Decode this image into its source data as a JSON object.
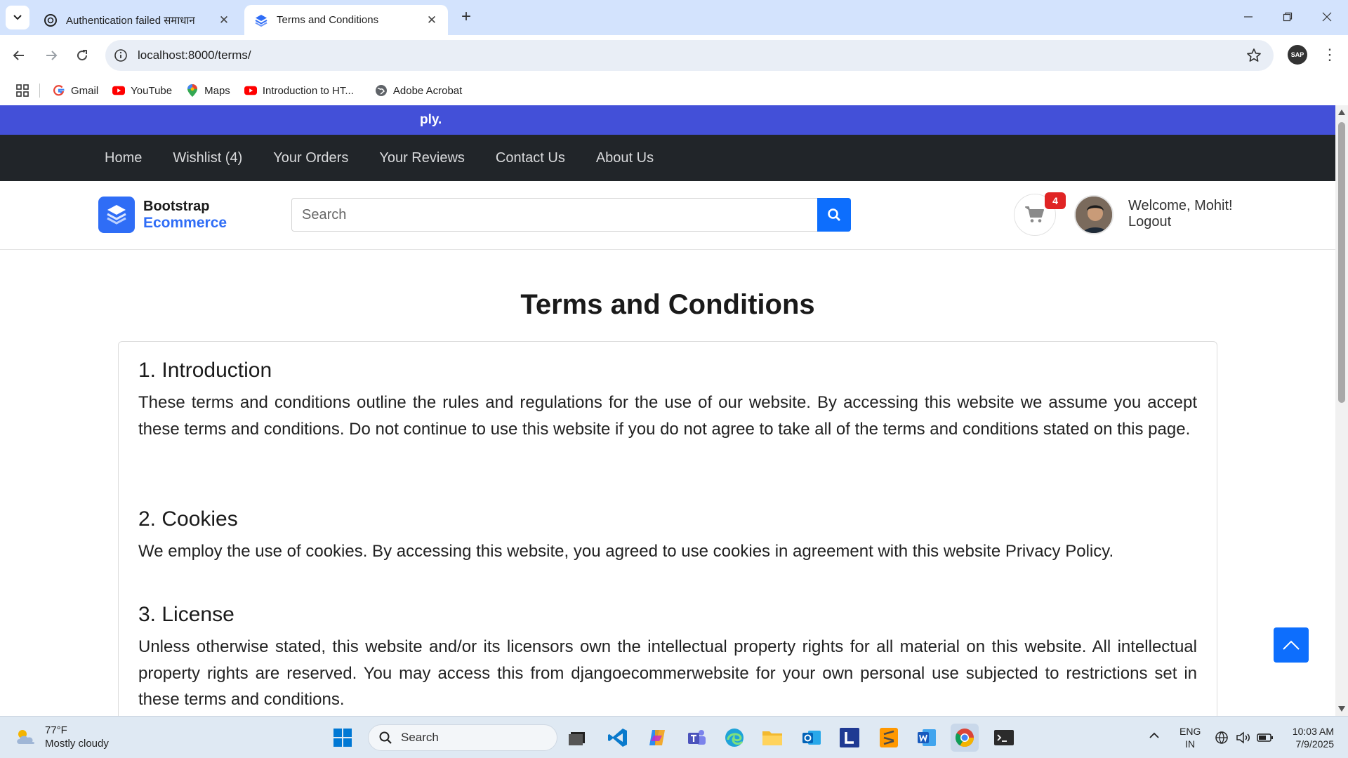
{
  "browser": {
    "tabs": [
      {
        "title": "Authentication failed समाधान",
        "active": false,
        "icon": "openai-icon"
      },
      {
        "title": "Terms and Conditions",
        "active": true,
        "icon": "layers-icon"
      }
    ],
    "url": "localhost:8000/terms/",
    "bookmarks": [
      {
        "label": "Gmail",
        "icon": "google-icon"
      },
      {
        "label": "YouTube",
        "icon": "youtube-icon"
      },
      {
        "label": "Maps",
        "icon": "maps-icon"
      },
      {
        "label": "Introduction to HT...",
        "icon": "youtube-icon"
      },
      {
        "label": "Adobe Acrobat",
        "icon": "globe-icon"
      }
    ],
    "profile_text": "SAP"
  },
  "site": {
    "topbar_text": "ply.",
    "nav": [
      "Home",
      "Wishlist (4)",
      "Your Orders",
      "Your Reviews",
      "Contact Us",
      "About Us"
    ],
    "brand": {
      "line1": "Bootstrap",
      "line2": "Ecommerce"
    },
    "search_placeholder": "Search",
    "cart_count": "4",
    "welcome": "Welcome, Mohit!",
    "logout": "Logout",
    "colors": {
      "topbar": "#4350d8",
      "navbar": "#212529",
      "primary": "#0d6efd",
      "badge": "#e02424"
    }
  },
  "content": {
    "title": "Terms and Conditions",
    "sections": [
      {
        "heading": "1. Introduction",
        "body": "These terms and conditions outline the rules and regulations for the use of our website. By accessing this website we assume you accept these terms and conditions. Do not continue to use this website if you do not agree to take all of the terms and conditions stated on this page."
      },
      {
        "heading": "2. Cookies",
        "body": "We employ the use of cookies. By accessing this website, you agreed to use cookies in agreement with this website Privacy Policy."
      },
      {
        "heading": "3. License",
        "body": "Unless otherwise stated, this website and/or its licensors own the intellectual property rights for all material on this website. All intellectual property rights are reserved. You may access this from djangoecommerwebsite for your own personal use subjected to restrictions set in these terms and conditions."
      }
    ]
  },
  "taskbar": {
    "weather_temp": "77°F",
    "weather_desc": "Mostly cloudy",
    "search_placeholder": "Search",
    "lang_1": "ENG",
    "lang_2": "IN",
    "time": "10:03 AM",
    "date": "7/9/2025"
  }
}
